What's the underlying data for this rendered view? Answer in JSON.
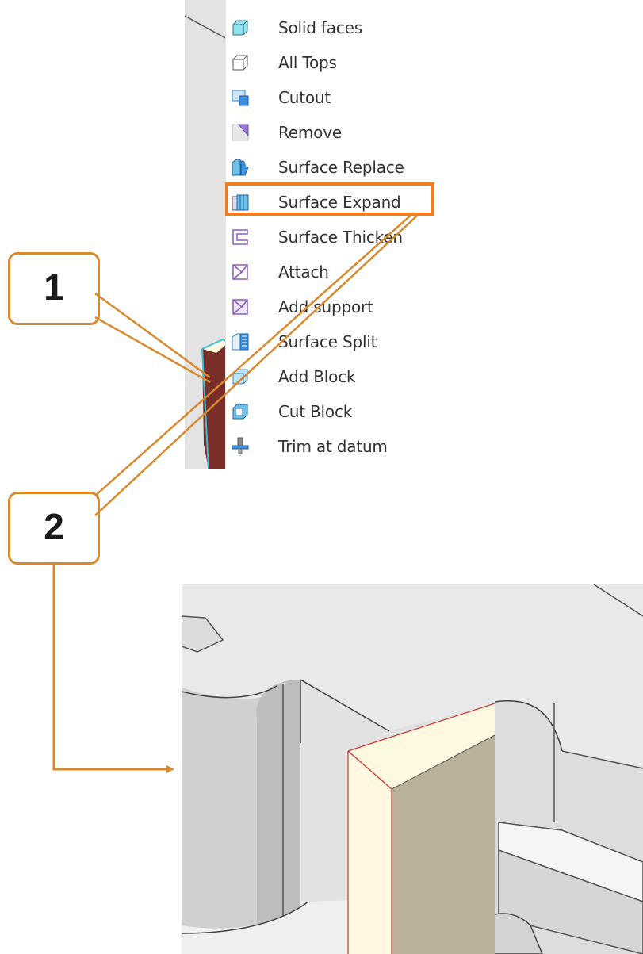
{
  "menu": {
    "items": [
      {
        "label": "Solid faces",
        "icon": "solid-faces-icon"
      },
      {
        "label": "All Tops",
        "icon": "all-tops-icon"
      },
      {
        "label": "Cutout",
        "icon": "cutout-icon"
      },
      {
        "label": "Remove",
        "icon": "remove-icon"
      },
      {
        "label": "Surface Replace",
        "icon": "surface-replace-icon"
      },
      {
        "label": "Surface Expand",
        "icon": "surface-expand-icon"
      },
      {
        "label": "Surface Thicken",
        "icon": "surface-thicken-icon"
      },
      {
        "label": "Attach",
        "icon": "attach-icon"
      },
      {
        "label": "Add support",
        "icon": "add-support-icon"
      },
      {
        "label": "Surface Split",
        "icon": "surface-split-icon"
      },
      {
        "label": "Add Block",
        "icon": "add-block-icon"
      },
      {
        "label": "Cut Block",
        "icon": "cut-block-icon"
      },
      {
        "label": "Trim at datum",
        "icon": "trim-at-datum-icon"
      }
    ],
    "highlighted_item": "Surface Expand"
  },
  "callouts": {
    "first": "1",
    "second": "2"
  },
  "colors": {
    "callout_border": "#d9892c",
    "highlight": "#f07d1e",
    "arrow": "#d9892c",
    "selected_face": "#7a2e2a",
    "block_top": "#fdf8e0",
    "block_side": "#b9b19a"
  }
}
